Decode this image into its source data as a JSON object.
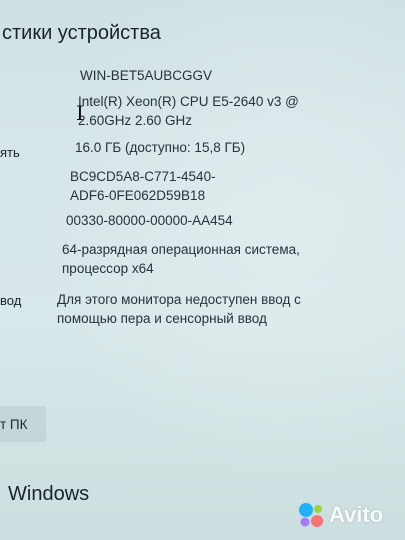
{
  "section_title": "стики устройства",
  "rows": {
    "device_name": {
      "value": "WIN-BET5AUBCGGV"
    },
    "processor": {
      "value_line1": "Intel(R) Xeon(R) CPU E5-2640 v3 @",
      "value_line2": "2.60GHz   2.60 GHz"
    },
    "ram": {
      "label": "ять",
      "value": "16.0 ГБ (доступно: 15,8 ГБ)"
    },
    "device_id": {
      "value_line1": "BC9CD5A8-C771-4540-",
      "value_line2": "ADF6-0FE062D59B18"
    },
    "product_id": {
      "value": "00330-80000-00000-AA454"
    },
    "system_type": {
      "value_line1": "64-разрядная операционная система,",
      "value_line2": "процессор x64"
    },
    "pen_touch": {
      "label": "вод",
      "value_line1": "Для этого монитора недоступен ввод с",
      "value_line2": "помощью пера и сенсорный ввод"
    }
  },
  "rename_button_label": "т ПК",
  "windows_heading": "Windows",
  "watermark": {
    "text": "Avito",
    "dot_colors": [
      "#00aaff",
      "#97cf26",
      "#ff6163",
      "#a169f7"
    ]
  }
}
